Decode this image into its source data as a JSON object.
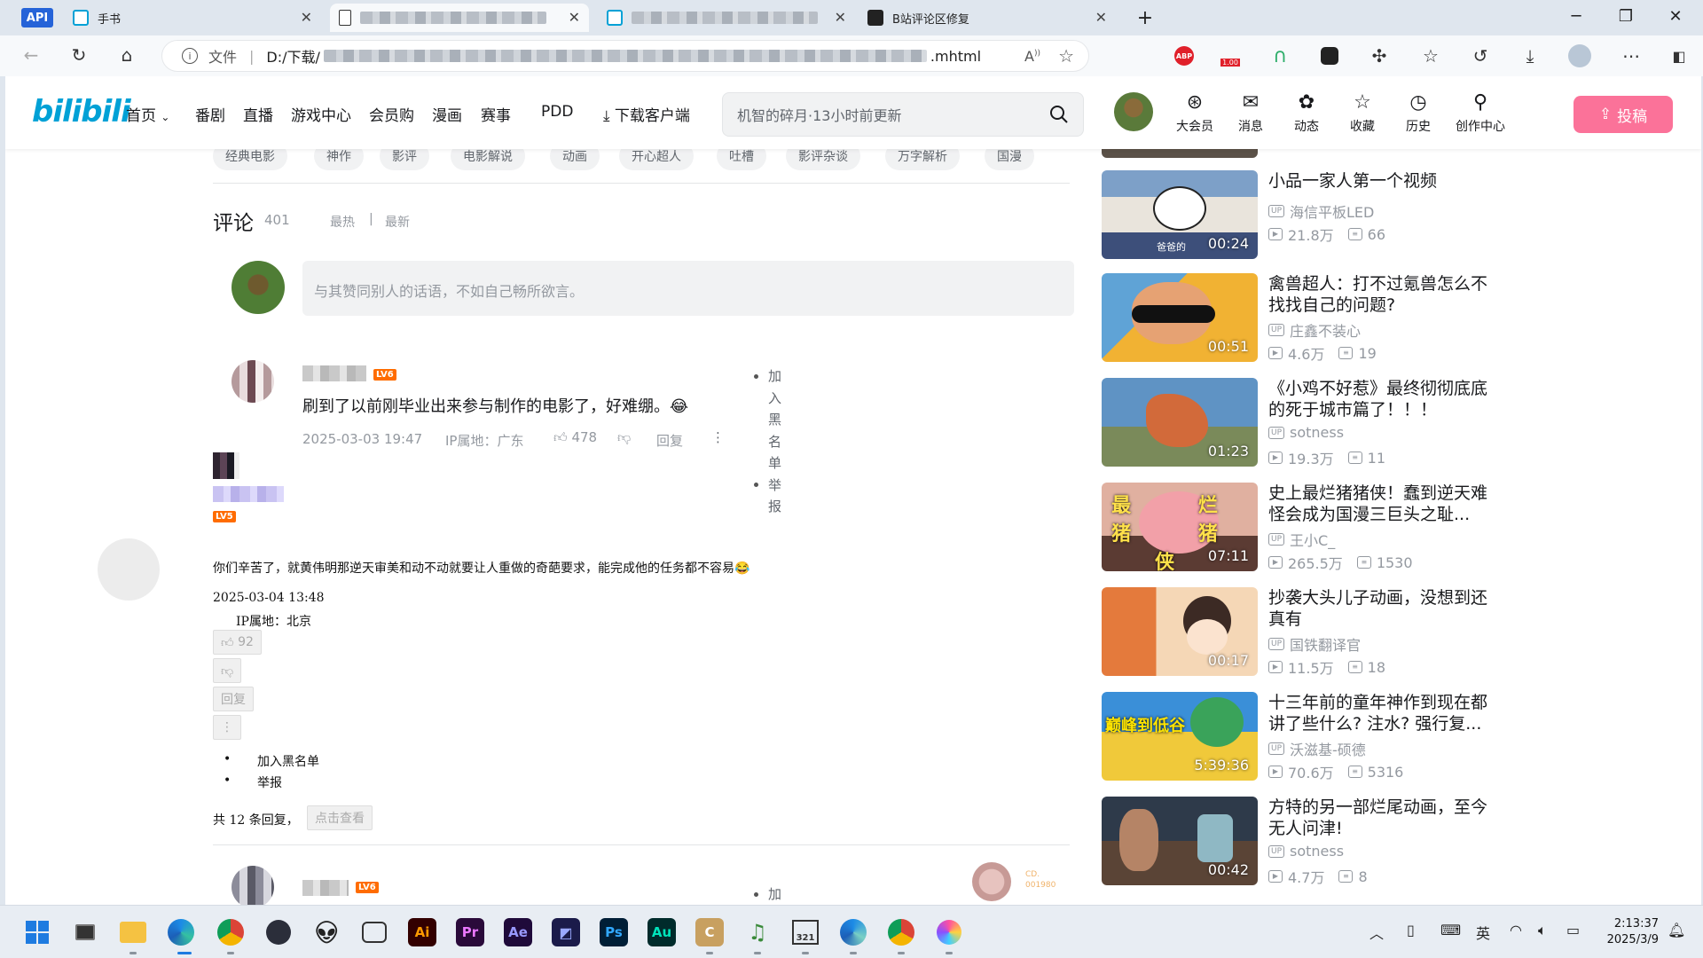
{
  "browser": {
    "tabs": [
      {
        "label": "API",
        "kind": "badge"
      },
      {
        "label": "手书",
        "kind": "tab"
      },
      {
        "label": "",
        "kind": "blurred-active"
      },
      {
        "label": "",
        "kind": "blurred"
      },
      {
        "label": "B站评论区修复",
        "kind": "tab"
      }
    ],
    "url_prefix": "D:/下载/",
    "url_suffix": ".mhtml",
    "url_label": "文件",
    "new_tab": "+",
    "abp_label": "ABP",
    "ext_badge": "1.00"
  },
  "bili": {
    "logo": "bilibili",
    "nav": [
      "首页",
      "番剧",
      "直播",
      "游戏中心",
      "会员购",
      "漫画",
      "赛事",
      "PDD"
    ],
    "download_client": "下载客户端",
    "search_placeholder": "机智的碎月·13小时前更新",
    "header_icons": [
      {
        "label": "大会员",
        "icon": "vip-icon"
      },
      {
        "label": "消息",
        "icon": "message-icon"
      },
      {
        "label": "动态",
        "icon": "dynamic-icon"
      },
      {
        "label": "收藏",
        "icon": "favorite-icon"
      },
      {
        "label": "历史",
        "icon": "history-icon"
      },
      {
        "label": "创作中心",
        "icon": "creator-icon"
      }
    ],
    "upload": "投稿"
  },
  "tags": [
    "经典电影",
    "神作",
    "影评",
    "电影解说",
    "动画",
    "开心超人",
    "吐槽",
    "影评杂谈",
    "万字解析",
    "国漫"
  ],
  "comments_header": {
    "title": "评论",
    "count": "401",
    "sort_hot": "最热",
    "sort_sep": "|",
    "sort_new": "最新",
    "input_placeholder": "与其赞同别人的话语，不如自己畅所欲言。"
  },
  "comment1": {
    "level": "LV6",
    "text": "刷到了以前刚毕业出来参与制作的电影了，好难绷。😂",
    "date": "2025-03-03 19:47",
    "ip": "IP属地：广东",
    "likes": "478",
    "reply": "回复",
    "menu_chars_1": [
      "加",
      "入",
      "黑",
      "名",
      "单"
    ],
    "menu_chars_2": [
      "举",
      "报"
    ]
  },
  "reply1": {
    "level": "LV5",
    "text": "你们辛苦了，就黄伟明那逆天审美和动不动就要让人重做的奇葩要求，能完成他的任务都不容易😂",
    "date": "2025-03-04 13:48",
    "ip": "IP属地：北京",
    "likes": "92",
    "reply": "回复",
    "more": "⋮",
    "menu": [
      "加入黑名单",
      "举报"
    ],
    "total_prefix": "共 12 条回复，",
    "view_btn": "点击查看"
  },
  "comment2": {
    "level": "LV6",
    "menu_first": "加",
    "sticker_id": "CD.\n001980"
  },
  "videos": [
    {
      "title": "小品一家人第一个视频",
      "up": "海信平板LED",
      "views": "21.8万",
      "danmaku": "66",
      "duration": "00:24",
      "thumb_caption": "爸爸的"
    },
    {
      "title": "禽兽超人：打不过氪兽怎么不找找自己的问题?",
      "up": "庄鑫不装心",
      "views": "4.6万",
      "danmaku": "19",
      "duration": "00:51"
    },
    {
      "title": "《小鸡不好惹》最终彻彻底底的死于城市篇了！！！",
      "up": "sotness",
      "views": "19.3万",
      "danmaku": "11",
      "duration": "01:23"
    },
    {
      "title": "史上最烂猪猪侠！蠢到逆天难怪会成为国漫三巨头之耻...",
      "up": "王小C_",
      "views": "265.5万",
      "danmaku": "1530",
      "duration": "07:11",
      "thumb_caption": "最 烂 猪 猪 侠"
    },
    {
      "title": "抄袭大头儿子动画，没想到还真有",
      "up": "国铁翻译官",
      "views": "11.5万",
      "danmaku": "18",
      "duration": "00:17"
    },
    {
      "title": "十三年前的童年神作到现在都讲了些什么? 注水? 强行复...",
      "up": "沃滋基-硕德",
      "views": "70.6万",
      "danmaku": "5316",
      "duration": "5:39:36",
      "thumb_caption": "巅峰到低谷"
    },
    {
      "title": "方特的另一部烂尾动画，至今无人问津!",
      "up": "sotness",
      "views": "4.7万",
      "danmaku": "8",
      "duration": "00:42"
    }
  ],
  "taskbar": {
    "time": "2:13:37",
    "date": "2025/3/9",
    "ime": "英",
    "apps": [
      "start",
      "taskview",
      "explorer",
      "edge",
      "chrome",
      "obs",
      "alien",
      "bilibili-app",
      "Ai",
      "Pr",
      "Ae",
      "premiere-alt",
      "Ps",
      "Au",
      "C",
      "music",
      "calendar-321",
      "edge-dev",
      "chrome-2",
      "color-app"
    ]
  },
  "colors": {
    "bili_blue": "#00a1d6",
    "bili_pink": "#fb7299",
    "text_gray": "#9499a0"
  }
}
